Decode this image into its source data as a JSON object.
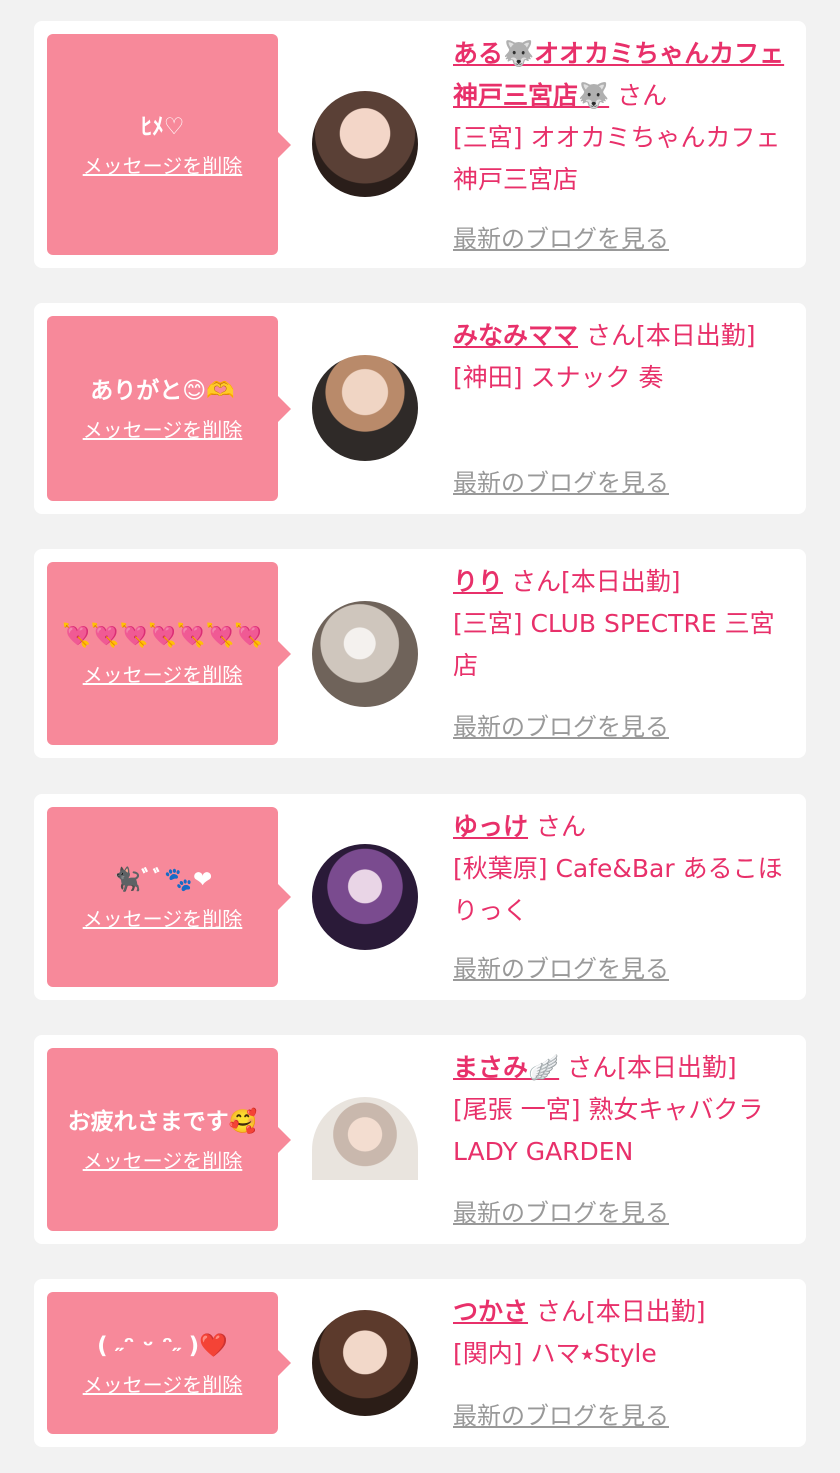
{
  "threads": [
    {
      "message": "ﾋﾒ♡",
      "delete_label": "メッセージを削除",
      "name": "ある🐺オオカミちゃんカフェ神戸三宮店🐺",
      "honorific": "さん",
      "status": "",
      "shop": "[三宮] オオカミちゃんカフェ神戸三宮店",
      "blog_label": "最新のブログを見る"
    },
    {
      "message": "ありがと😊🫶",
      "delete_label": "メッセージを削除",
      "name": "みなみママ",
      "honorific": "さん",
      "status": "[本日出勤]",
      "shop": "[神田] スナック 奏",
      "blog_label": "最新のブログを見る"
    },
    {
      "message": "💘💘💘💘💘💘💘",
      "delete_label": "メッセージを削除",
      "name": "りり",
      "honorific": "さん",
      "status": "[本日出勤]",
      "shop": "[三宮] CLUB SPECTRE 三宮店",
      "blog_label": "最新のブログを見る"
    },
    {
      "message": "🐈‍⬛ﾞﾞ🐾❤",
      "delete_label": "メッセージを削除",
      "name": "ゆっけ",
      "honorific": "さん",
      "status": "",
      "shop": "[秋葉原] Cafe&Bar あるこほりっく",
      "blog_label": "最新のブログを見る"
    },
    {
      "message": "お疲れさまです🥰",
      "delete_label": "メッセージを削除",
      "name": "まさみ🪽",
      "honorific": "さん",
      "status": "[本日出勤]",
      "shop": "[尾張 一宮] 熟女キャバクラLADY GARDEN",
      "blog_label": "最新のブログを見る"
    },
    {
      "message": "( ˶ᵔ ᵕ ᵔ˶ )❤️",
      "delete_label": "メッセージを削除",
      "name": "つかさ",
      "honorific": "さん",
      "status": "[本日出勤]",
      "shop": "[関内] ハマ⭑Style",
      "blog_label": "最新のブログを見る"
    }
  ],
  "colors": {
    "accent": "#e8306a",
    "bubble": "#f7899a",
    "muted": "#999999",
    "background": "#f2f2f2"
  }
}
